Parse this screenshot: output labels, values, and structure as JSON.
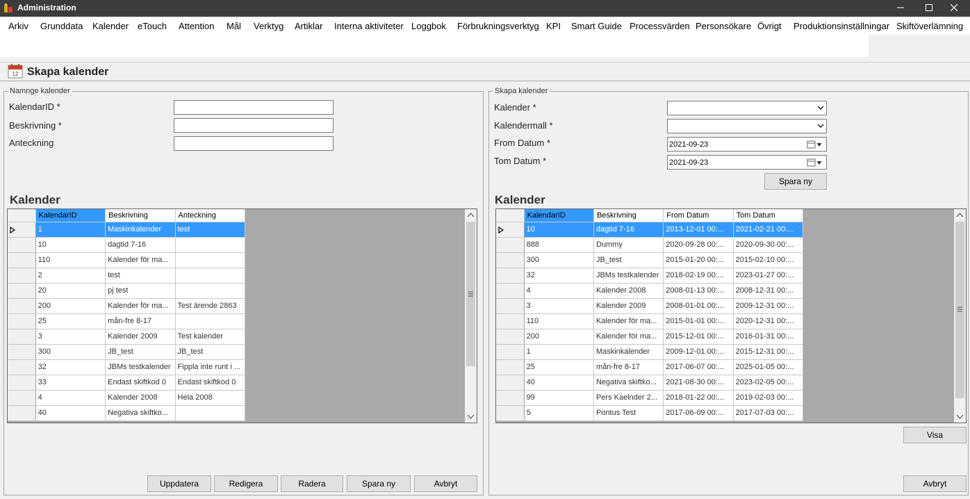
{
  "window": {
    "title": "Administration"
  },
  "menu": [
    "Arkiv",
    "Grunddata",
    "Kalender",
    "eTouch",
    "Attention",
    "Mål",
    "Verktyg",
    "Artiklar",
    "Interna aktiviteter",
    "Loggbok",
    "Förbrukningsverktyg",
    "KPI",
    "Smart Guide",
    "Processvärden",
    "Personsökare",
    "Övrigt",
    "Produktionsinställningar",
    "Skiftöverlämning"
  ],
  "page": {
    "title": "Skapa kalender"
  },
  "left": {
    "group_label": "Namnge kalender",
    "fields": [
      {
        "label": "KalendarID *",
        "value": ""
      },
      {
        "label": "Beskrivning *",
        "value": ""
      },
      {
        "label": "Anteckning",
        "value": ""
      }
    ],
    "section_title": "Kalender",
    "grid": {
      "columns": [
        "KalendarID",
        "Beskrivning",
        "Anteckning"
      ],
      "rows": [
        [
          "1",
          "Maskinkalender",
          "test"
        ],
        [
          "10",
          "dagtid 7-16",
          ""
        ],
        [
          "110",
          "Kalender för ma...",
          ""
        ],
        [
          "2",
          "test",
          ""
        ],
        [
          "20",
          "pj test",
          ""
        ],
        [
          "200",
          "Kalender för ma...",
          "Test ärende 2863"
        ],
        [
          "25",
          "mån-fre 8-17",
          ""
        ],
        [
          "3",
          "Kalender 2009",
          "Test kalender"
        ],
        [
          "300",
          "JB_test",
          "JB_test"
        ],
        [
          "32",
          "JBMs testkalender",
          "Fippla inte runt i ..."
        ],
        [
          "33",
          "Endast skiftkod 0",
          "Endast skiftkod 0"
        ],
        [
          "4",
          "Kalender 2008",
          "Hela 2008"
        ],
        [
          "40",
          "Negativa skiftko...",
          ""
        ]
      ]
    },
    "buttons": {
      "update": "Uppdatera",
      "edit": "Redigera",
      "delete": "Radera",
      "save_new": "Spara ny",
      "cancel": "Avbryt"
    }
  },
  "right": {
    "group_label": "Skapa kalender",
    "fields": {
      "kalender_label": "Kalender *",
      "kalender_value": "",
      "mall_label": "Kalendermall *",
      "mall_value": "",
      "from_label": "From Datum *",
      "from_value": "2021-09-23",
      "tom_label": "Tom Datum *",
      "tom_value": "2021-09-23"
    },
    "save_new": "Spara ny",
    "section_title": "Kalender",
    "grid": {
      "columns": [
        "KalendarID",
        "Beskrivning",
        "From Datum",
        "Tom Datum"
      ],
      "rows": [
        [
          "10",
          "dagtid 7-16",
          "2013-12-01 00:...",
          "2021-02-21 00:..."
        ],
        [
          "888",
          "Dummy",
          "2020-09-28 00:...",
          "2020-09-30 00:..."
        ],
        [
          "300",
          "JB_test",
          "2015-01-20 00:...",
          "2015-02-10 00:..."
        ],
        [
          "32",
          "JBMs testkalender",
          "2018-02-19 00:...",
          "2023-01-27 00:..."
        ],
        [
          "4",
          "Kalender 2008",
          "2008-01-13 00:...",
          "2008-12-31 00:..."
        ],
        [
          "3",
          "Kalender 2009",
          "2008-01-01 00:...",
          "2009-12-31 00:..."
        ],
        [
          "110",
          "Kalender för ma...",
          "2015-01-01 00:...",
          "2020-12-31 00:..."
        ],
        [
          "200",
          "Kalender för ma...",
          "2015-12-01 00:...",
          "2016-01-31 00:..."
        ],
        [
          "1",
          "Maskinkalender",
          "2009-12-01 00:...",
          "2015-12-31 00:..."
        ],
        [
          "25",
          "mån-fre 8-17",
          "2017-06-07 00:...",
          "2025-01-05 00:..."
        ],
        [
          "40",
          "Negativa skiftko...",
          "2021-08-30 00:...",
          "2023-02-05 00:..."
        ],
        [
          "99",
          "Pers Kaelnder 2...",
          "2018-01-22 00:...",
          "2019-02-03 00:..."
        ],
        [
          "5",
          "Pontus Test",
          "2017-06-09 00:...",
          "2017-07-03 00:..."
        ]
      ]
    },
    "show": "Visa",
    "cancel": "Avbryt"
  }
}
